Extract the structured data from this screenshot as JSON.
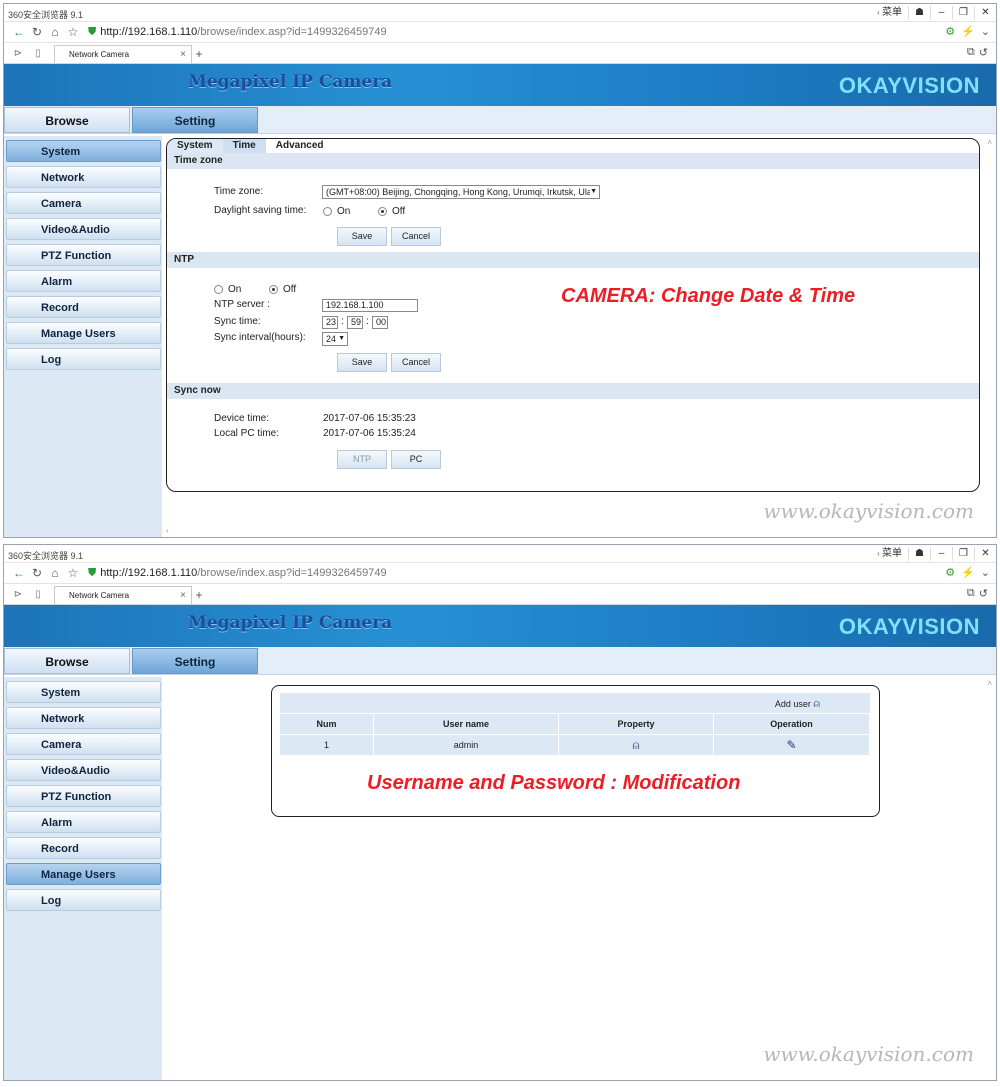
{
  "browser": {
    "title": "360安全浏览器 9.1",
    "url_host": "http://192.168.1.110",
    "url_path": "/browse/index.asp?id=1499326459749",
    "tab_title": "Network Camera",
    "win_extra": "菜单"
  },
  "app": {
    "brand": "Megapixel IP Camera",
    "company": "OKAYVISION",
    "tab_browse": "Browse",
    "tab_setting": "Setting",
    "watermark": "www.okayvision.com"
  },
  "sidebar": {
    "items": [
      "System",
      "Network",
      "Camera",
      "Video&Audio",
      "PTZ Function",
      "Alarm",
      "Record",
      "Manage Users",
      "Log"
    ]
  },
  "settings": {
    "subtabs": [
      "System",
      "Time",
      "Advanced"
    ],
    "timezone": {
      "header": "Time zone",
      "tz_label": "Time zone:",
      "tz_value": "(GMT+08:00) Beijing, Chongqing, Hong Kong, Urumqi, Irkutsk, Ulaa",
      "dst_label": "Daylight saving time:",
      "on": "On",
      "off": "Off",
      "save": "Save",
      "cancel": "Cancel"
    },
    "ntp": {
      "header": "NTP",
      "on": "On",
      "off": "Off",
      "server_label": "NTP server :",
      "server_value": "192.168.1.100",
      "sync_label": "Sync time:",
      "hh": "23",
      "mm": "59",
      "ss": "00",
      "interval_label": "Sync interval(hours):",
      "interval_value": "24",
      "save": "Save",
      "cancel": "Cancel"
    },
    "syncnow": {
      "header": "Sync now",
      "device_label": "Device time:",
      "device_value": "2017-07-06 15:35:23",
      "pc_label": "Local PC time:",
      "pc_value": "2017-07-06 15:35:24",
      "ntp_btn": "NTP",
      "pc_btn": "PC"
    },
    "overlay": "CAMERA: Change Date & Time"
  },
  "users": {
    "add_user": "Add user",
    "headers": [
      "Num",
      "User name",
      "Property",
      "Operation"
    ],
    "rows": [
      {
        "num": "1",
        "name": "admin"
      }
    ],
    "overlay": "Username and Password : Modification"
  }
}
